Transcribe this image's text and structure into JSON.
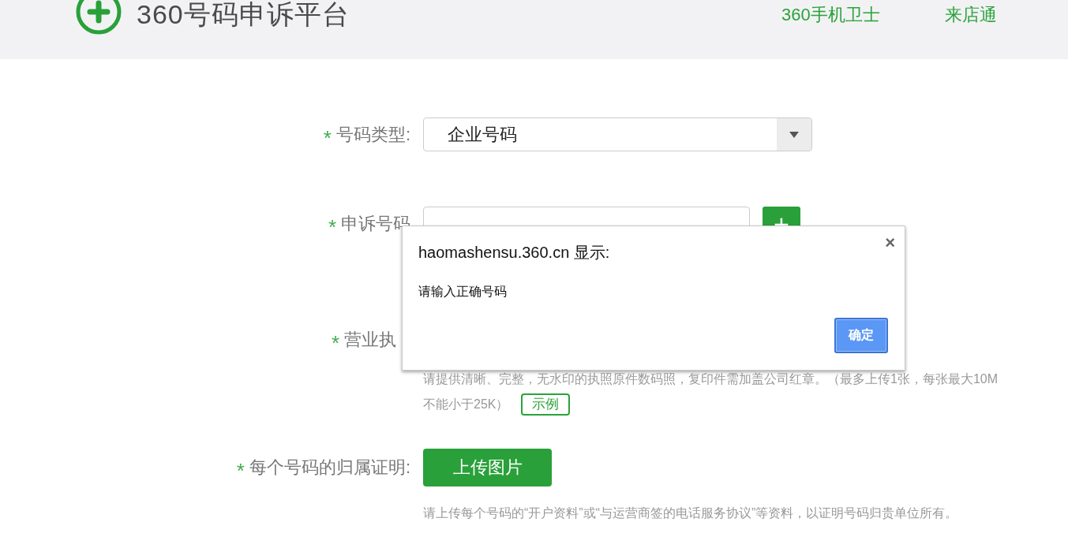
{
  "header": {
    "title": "360号码申诉平台",
    "nav": [
      {
        "label": "360手机卫士"
      },
      {
        "label": "来店通"
      }
    ]
  },
  "form": {
    "rows": [
      {
        "kind": "select",
        "mark": "*",
        "label": "号码类型:",
        "value": "企业号码"
      },
      {
        "kind": "input",
        "mark": "*",
        "label": "申诉号码",
        "add": "+"
      },
      {
        "kind": "upload",
        "mark": "*",
        "label": "营业执",
        "hint": [
          "请提供清晰、完整，无水印的执照原件数码照，复印件需加盖公司红章。（最多上传1张，每张最大10M",
          "不能小于25K）"
        ],
        "example": "示例"
      },
      {
        "kind": "upload",
        "mark": "*",
        "label": "每个号码的归属证明:",
        "button": "上传图片",
        "hint": [
          "请上传每个号码的“开户资料”或“与运营商签的电话服务协议”等资料，以证明号码归贵单位所有。"
        ]
      }
    ]
  },
  "dialog": {
    "title": "haomashensu.360.cn 显示:",
    "message": "请输入正确号码",
    "close": "×",
    "ok": "确定"
  }
}
